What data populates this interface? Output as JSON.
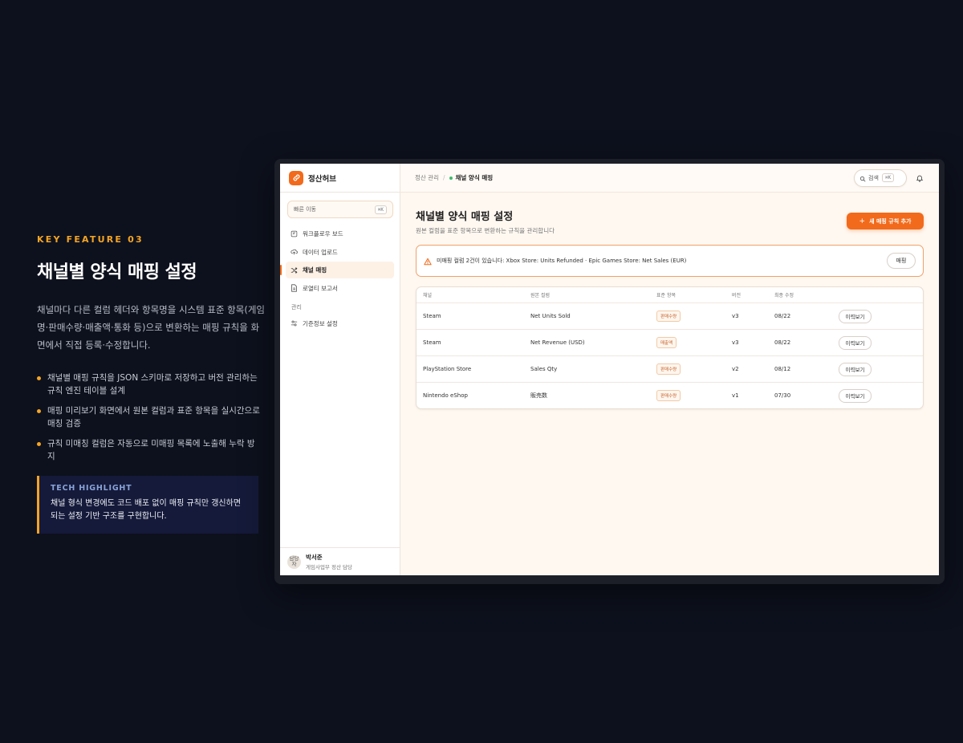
{
  "feature": {
    "kicker": "KEY FEATURE 03",
    "title": "채널별 양식 매핑 설정",
    "description": "채널마다 다른 컬럼 헤더와 항목명을 시스템 표준 항목(게임명·판매수량·매출액·통화 등)으로 변환하는 매핑 규칙을 화면에서 직접 등록·수정합니다.",
    "bullets": [
      "채널별 매핑 규칙을 JSON 스키마로 저장하고 버전 관리하는 규칙 엔진 테이블 설계",
      "매핑 미리보기 화면에서 원본 컬럼과 표준 항목을 실시간으로 매칭 검증",
      "규칙 미매칭 컬럼은 자동으로 미매핑 목록에 노출해 누락 방지"
    ],
    "highlight": {
      "title": "TECH HIGHLIGHT",
      "body": "채널 형식 변경에도 코드 배포 없이 매핑 규칙만 갱신하면 되는 설정 기반 구조를 구현합니다."
    }
  },
  "app": {
    "brand": "정산허브",
    "quick_move": {
      "label": "빠른 이동",
      "shortcut": "⌘K"
    },
    "nav": [
      {
        "label": "워크플로우 보드",
        "icon": "board-icon"
      },
      {
        "label": "데이터 업로드",
        "icon": "cloud-upload-icon"
      },
      {
        "label": "채널 매핑",
        "icon": "shuffle-icon",
        "active": true
      },
      {
        "label": "로열티 보고서",
        "icon": "document-icon"
      }
    ],
    "nav_section": "관리",
    "nav_admin": [
      {
        "label": "기준정보 설정",
        "icon": "settings-sliders-icon"
      }
    ],
    "user": {
      "avatar_alt": "담당자",
      "name": "박서준",
      "role": "게임사업부 정산 담당"
    },
    "breadcrumb": {
      "parent": "정산 관리",
      "separator": "/",
      "current": "채널 양식 매핑"
    },
    "search": {
      "label": "검색",
      "shortcut": "⌘K"
    },
    "page": {
      "title": "채널별 양식 매핑 설정",
      "subtitle": "원본 컬럼을 표준 항목으로 변환하는 규칙을 관리합니다",
      "add_button": "새 매핑 규칙 추가"
    },
    "alert": {
      "text": "미매핑 컬럼 2건이 있습니다: Xbox Store: Units Refunded · Epic Games Store: Net Sales (EUR)",
      "button": "매핑"
    },
    "table": {
      "headers": [
        "채널",
        "원본 컬럼",
        "표준 항목",
        "버전",
        "최종 수정"
      ],
      "rows": [
        {
          "channel": "Steam",
          "source": "Net Units Sold",
          "standard": "판매수량",
          "version": "v3",
          "updated": "08/22",
          "action": "이력보기"
        },
        {
          "channel": "Steam",
          "source": "Net Revenue (USD)",
          "standard": "매출액",
          "version": "v3",
          "updated": "08/22",
          "action": "이력보기"
        },
        {
          "channel": "PlayStation Store",
          "source": "Sales Qty",
          "standard": "판매수량",
          "version": "v2",
          "updated": "08/12",
          "action": "이력보기"
        },
        {
          "channel": "Nintendo eShop",
          "source": "販売数",
          "standard": "판매수량",
          "version": "v1",
          "updated": "07/30",
          "action": "이력보기"
        }
      ]
    },
    "colors": {
      "accent": "#f26a1b",
      "highlight": "#f5a524",
      "background": "#0d111d"
    }
  }
}
